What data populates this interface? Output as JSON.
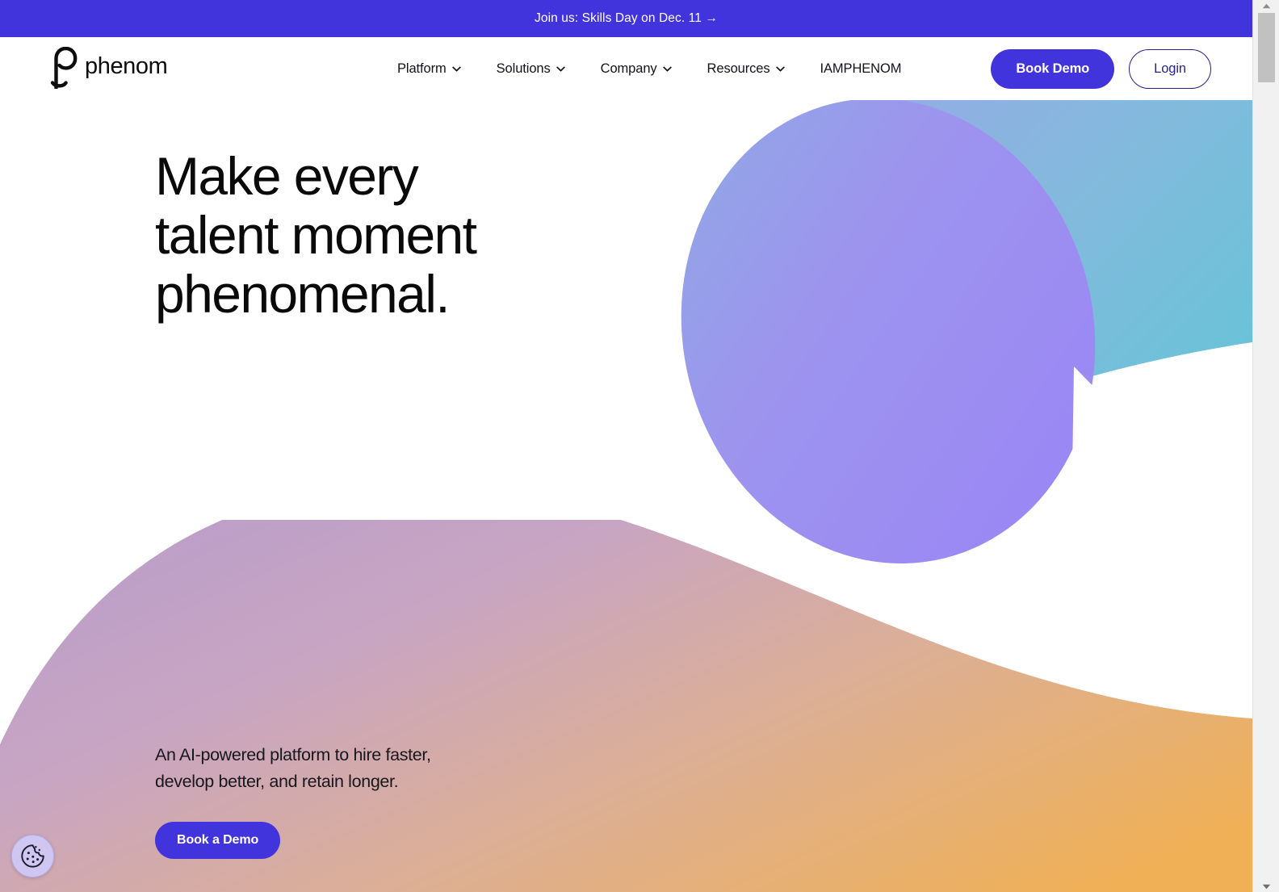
{
  "announcement": {
    "text": "Join us: Skills Day on Dec. 11 →"
  },
  "header": {
    "logo_text": "phenom",
    "nav": [
      {
        "label": "Platform",
        "has_chevron": true
      },
      {
        "label": "Solutions",
        "has_chevron": true
      },
      {
        "label": "Company",
        "has_chevron": true
      },
      {
        "label": "Resources",
        "has_chevron": true
      },
      {
        "label": "IAMPHENOM",
        "has_chevron": false
      }
    ],
    "book_demo_label": "Book Demo",
    "login_label": "Login"
  },
  "hero": {
    "headline": "Make every\ntalent moment\nphenomenal.",
    "subhead": "An AI-powered platform to hire faster,\ndevelop better, and retain longer.",
    "cta_label": "Book a Demo"
  },
  "cookie": {
    "icon": "cookie-icon"
  },
  "colors": {
    "brand_purple": "#4234dc",
    "login_navy": "#2a1f8f",
    "text_dark": "#0a0a0a",
    "ribbon_teal": "#6fc3d8",
    "ribbon_blue": "#8aa8e0",
    "ribbon_purple": "#9c8cf0",
    "ribbon_mauve": "#bda0cb",
    "ribbon_orange": "#efae52",
    "cookie_bg": "#cfc6f2"
  }
}
